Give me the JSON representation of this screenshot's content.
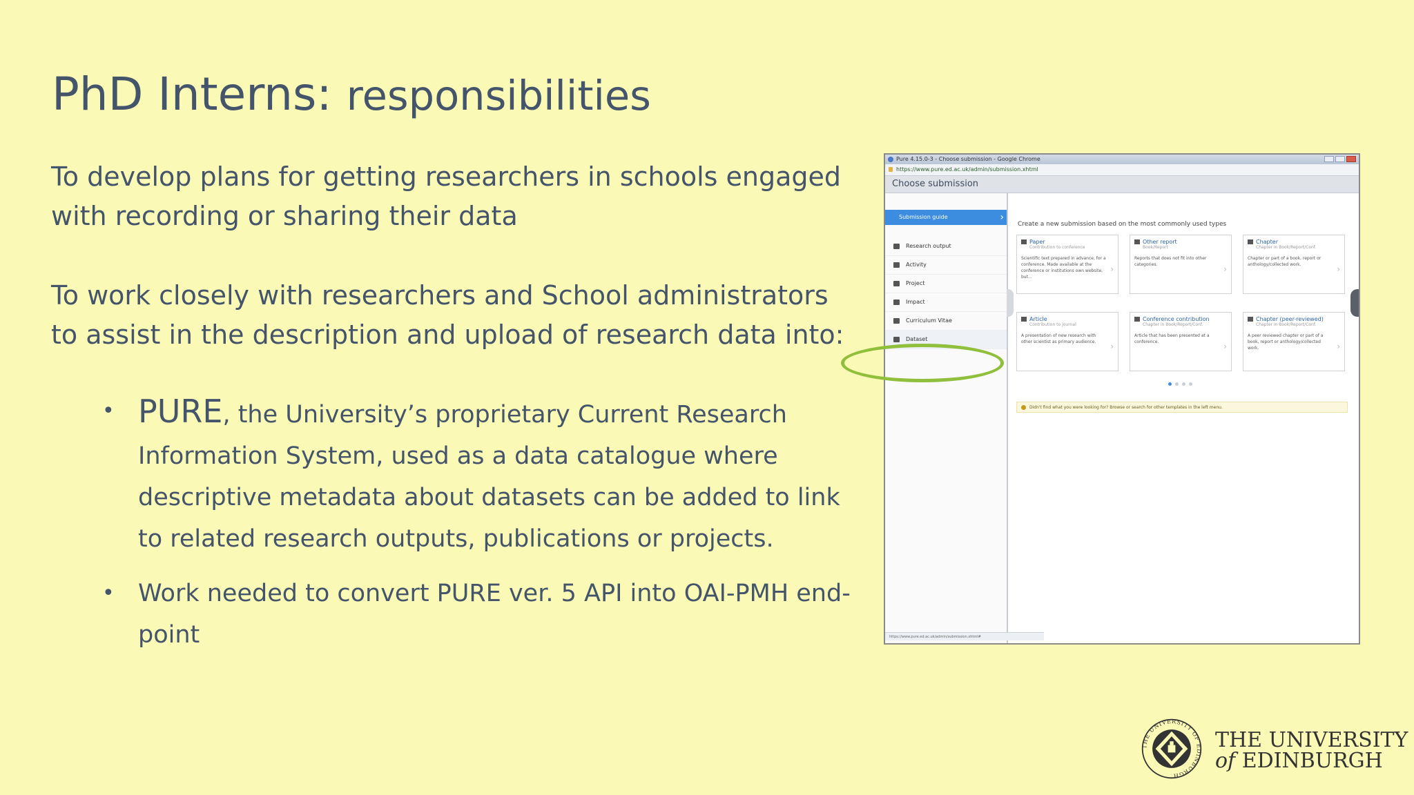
{
  "slide": {
    "title_main": "PhD Interns:",
    "title_sub": "responsibilities",
    "paragraph_1": [
      "To develop plans for getting researchers in schools engaged",
      "with recording  or sharing their data"
    ],
    "paragraph_2": [
      "To work closely with researchers and  School administrators",
      "to assist in the description and upload of research data into:"
    ],
    "bullets": [
      {
        "marker": "•",
        "lead": "PURE",
        "text": ", the University’s proprietary Current Research Information System, used as a data catalogue where descriptive metadata about datasets can be added to link to related research outputs, publications or projects."
      },
      {
        "marker": "•",
        "lead": "",
        "text": "Work needed to convert PURE ver. 5 API into OAI-PMH end-point"
      }
    ]
  },
  "screenshot": {
    "window_title": "Pure 4.15.0-3 - Choose submission - Google Chrome",
    "url": "https://www.pure.ed.ac.uk/admin/submission.xhtml",
    "header": "Choose submission",
    "sidebar_active": "Submission guide",
    "sidebar_items": [
      "Research output",
      "Activity",
      "Project",
      "Impact",
      "Curriculum Vitae",
      "Dataset"
    ],
    "hint": "Create a new submission based on the most commonly used types",
    "cards": [
      {
        "title": "Paper",
        "subtitle": "Contribution to conference",
        "desc": "Scientific text prepared in advance, for a conference. Made available at the conference or institutions own website, but..."
      },
      {
        "title": "Other report",
        "subtitle": "Book/Report",
        "desc": "Reports that does not fit into other categories."
      },
      {
        "title": "Chapter",
        "subtitle": "Chapter in Book/Report/Conf.",
        "desc": "Chapter or part of a book, report or anthology/collected work."
      },
      {
        "title": "Article",
        "subtitle": "Contribution to journal",
        "desc": "A presentation of new research with other scientist as primary audience."
      },
      {
        "title": "Conference contribution",
        "subtitle": "Chapter in Book/Report/Conf.",
        "desc": "Article that has been presented at a conference."
      },
      {
        "title": "Chapter (peer-reviewed)",
        "subtitle": "Chapter in Book/Report/Conf.",
        "desc": "A peer reviewed chapter or part of a book, report or anthology/collected work."
      }
    ],
    "notice": "Didn't find what you were looking for? Browse or search for other templates in the left menu.",
    "status_url": "https://www.pure.ed.ac.uk/admin/submission.xhtml#"
  },
  "logo": {
    "crest_text": "THE UNIVERSITY OF EDINBURGH",
    "line1": "THE UNIVERSITY",
    "line2_of": "of",
    "line2_rest": " EDINBURGH"
  },
  "colors": {
    "background": "#fbf9b6",
    "text": "#44546a",
    "highlight": "#8fbf3b",
    "pure_blue": "#3c8de0"
  }
}
